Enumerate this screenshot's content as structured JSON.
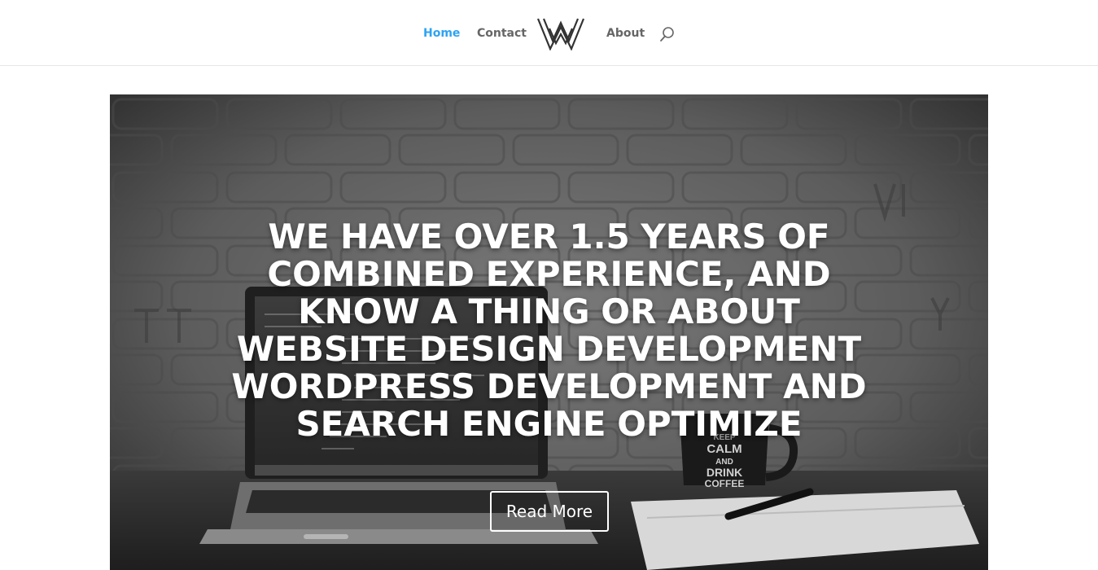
{
  "nav": {
    "home_label": "Home",
    "contact_label": "Contact",
    "about_label": "About",
    "logo_icon": "w-monogram-logo",
    "search_icon": "search-icon",
    "active_color": "#2ea3f2",
    "link_color": "#666666"
  },
  "hero": {
    "title": "WE HAVE OVER 1.5 YEARS OF COMBINED EXPERIENCE, AND KNOW A THING OR ABOUT WEBSITE DESIGN DEVELOPMENT WORDPRESS DEVELOPMENT AND SEARCH ENGINE OPTIMIZE",
    "button_label": "Read More",
    "mug_text_1": "KEEP",
    "mug_text_2": "CALM",
    "mug_text_3": "AND",
    "mug_text_4": "DRINK",
    "mug_text_5": "COFFEE"
  }
}
